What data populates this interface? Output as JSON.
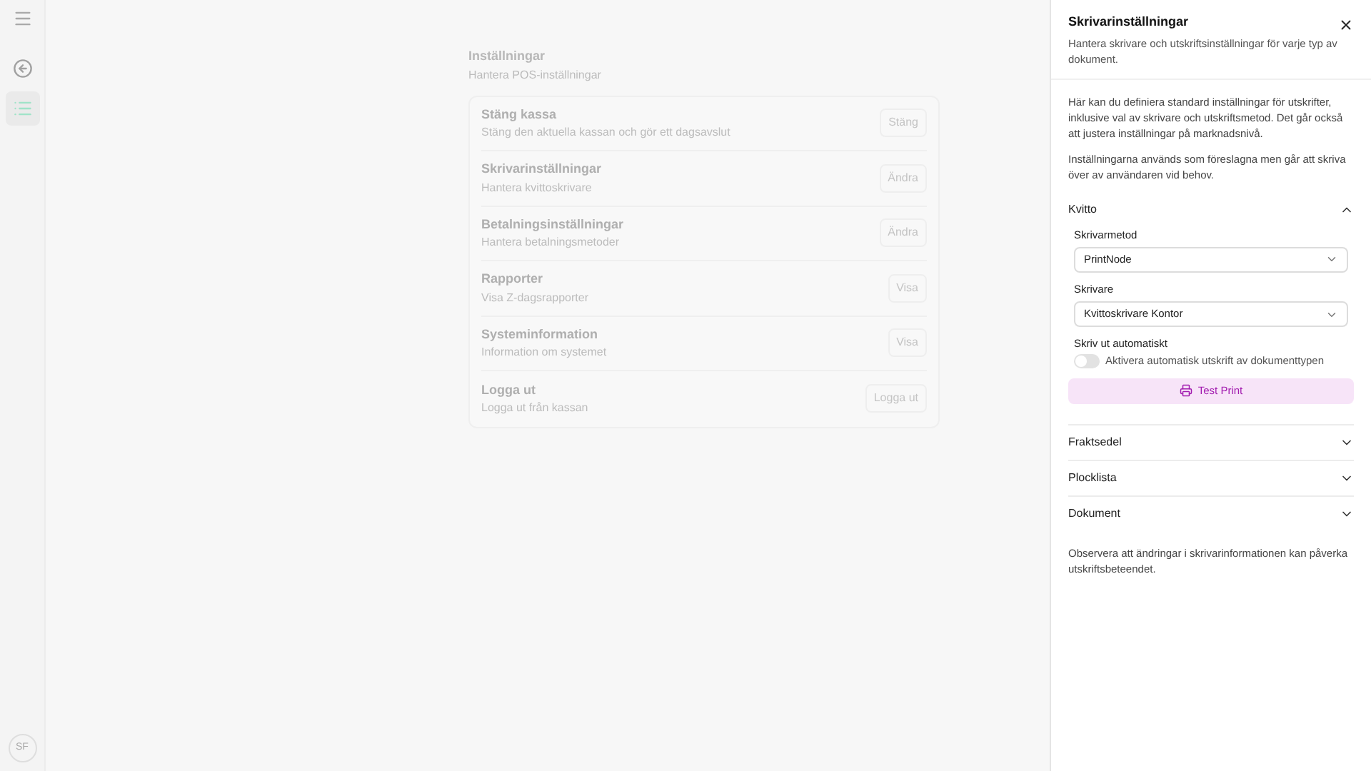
{
  "sidebar": {
    "items": [
      {
        "kind": "back",
        "selected": false
      },
      {
        "kind": "list",
        "selected": true
      }
    ],
    "avatar": "SF"
  },
  "settings": {
    "title": "Inställningar",
    "subtitle": "Hantera POS-inställningar",
    "items": [
      {
        "title": "Stäng kassa",
        "description": "Stäng den aktuella kassan och gör ett dagsavslut",
        "action": "Stäng"
      },
      {
        "title": "Skrivarinställningar",
        "description": "Hantera kvittoskrivare",
        "action": "Ändra"
      },
      {
        "title": "Betalningsinställningar",
        "description": "Hantera betalningsmetoder",
        "action": "Ändra"
      },
      {
        "title": "Rapporter",
        "description": "Visa Z-dagsrapporter",
        "action": "Visa"
      },
      {
        "title": "Systeminformation",
        "description": "Information om systemet",
        "action": "Visa"
      },
      {
        "title": "Logga ut",
        "description": "Logga ut från kassan",
        "action": "Logga ut"
      }
    ]
  },
  "panel": {
    "title": "Skrivarinställningar",
    "description": "Hantera skrivare och utskriftsinställningar för varje typ av dokument.",
    "intro": [
      "Här kan du definiera standard inställningar för utskrifter, inklusive val av skrivare och utskriftsmetod. Det går också att justera inställningar på marknadsnivå.",
      "Inställningarna används som föreslagna men går att skriva över av användaren vid behov."
    ],
    "sections": [
      {
        "title": "Kvitto",
        "expanded": true,
        "fields": [
          {
            "kind": "select",
            "label": "Skrivarmetod",
            "value": "PrintNode"
          },
          {
            "kind": "select",
            "label": "Skrivare",
            "value": "Kvittoskrivare Kontor"
          },
          {
            "kind": "toggle",
            "label": "Skriv ut automatiskt",
            "description": "Aktivera automatisk utskrift av dokumenttypen",
            "on": false
          }
        ],
        "button": "Test Print"
      },
      {
        "title": "Fraktsedel",
        "expanded": false
      },
      {
        "title": "Plocklista",
        "expanded": false
      },
      {
        "title": "Dokument",
        "expanded": false
      }
    ],
    "note": "Observera att ändringar i skrivarinformationen kan påverka utskriftsbeteendet."
  }
}
